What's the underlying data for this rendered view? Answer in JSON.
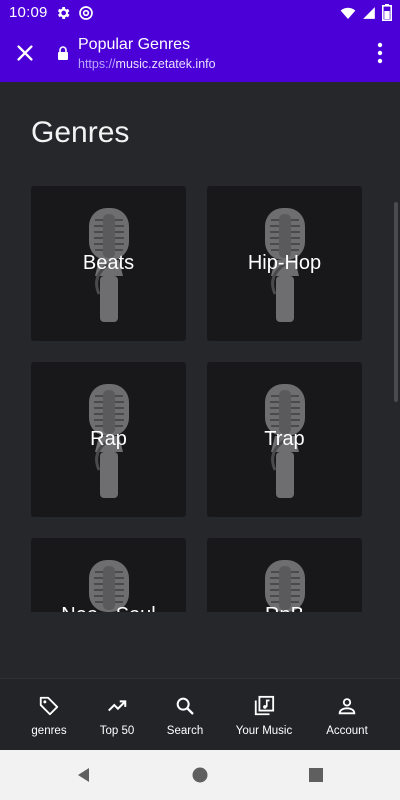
{
  "status_bar": {
    "time": "10:09",
    "icons": [
      "settings-icon",
      "at-icon",
      "wifi-icon",
      "signal-icon",
      "battery-icon"
    ]
  },
  "toolbar": {
    "title": "Popular Genres",
    "url_scheme": "https://",
    "url_host": "music.zetatek.info",
    "accent_color": "#4a00d6"
  },
  "page": {
    "heading": "Genres"
  },
  "genres": [
    {
      "label": "Beats"
    },
    {
      "label": "Hip-Hop"
    },
    {
      "label": "Rap"
    },
    {
      "label": "Trap"
    },
    {
      "label": "Neo - Soul"
    },
    {
      "label": "RnB"
    }
  ],
  "bottom_nav": {
    "items": [
      {
        "label": "genres",
        "icon": "tag-icon"
      },
      {
        "label": "Top 50",
        "icon": "trending-up-icon"
      },
      {
        "label": "Search",
        "icon": "search-icon"
      },
      {
        "label": "Your Music",
        "icon": "library-music-icon"
      },
      {
        "label": "Account",
        "icon": "person-icon"
      }
    ]
  },
  "system_nav": {
    "buttons": [
      "back-icon",
      "home-icon",
      "recents-icon"
    ]
  }
}
